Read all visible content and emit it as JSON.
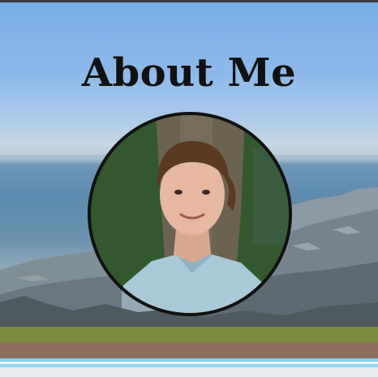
{
  "page": {
    "heading": "About Me"
  },
  "avatar": {
    "subject": "portrait-photo"
  },
  "colors": {
    "heading": "#111111",
    "sky": "#8db9e9",
    "band_green": "#7a8a3e",
    "band_brown": "#8b6f5b",
    "band_blue": "#7fd0f2"
  }
}
